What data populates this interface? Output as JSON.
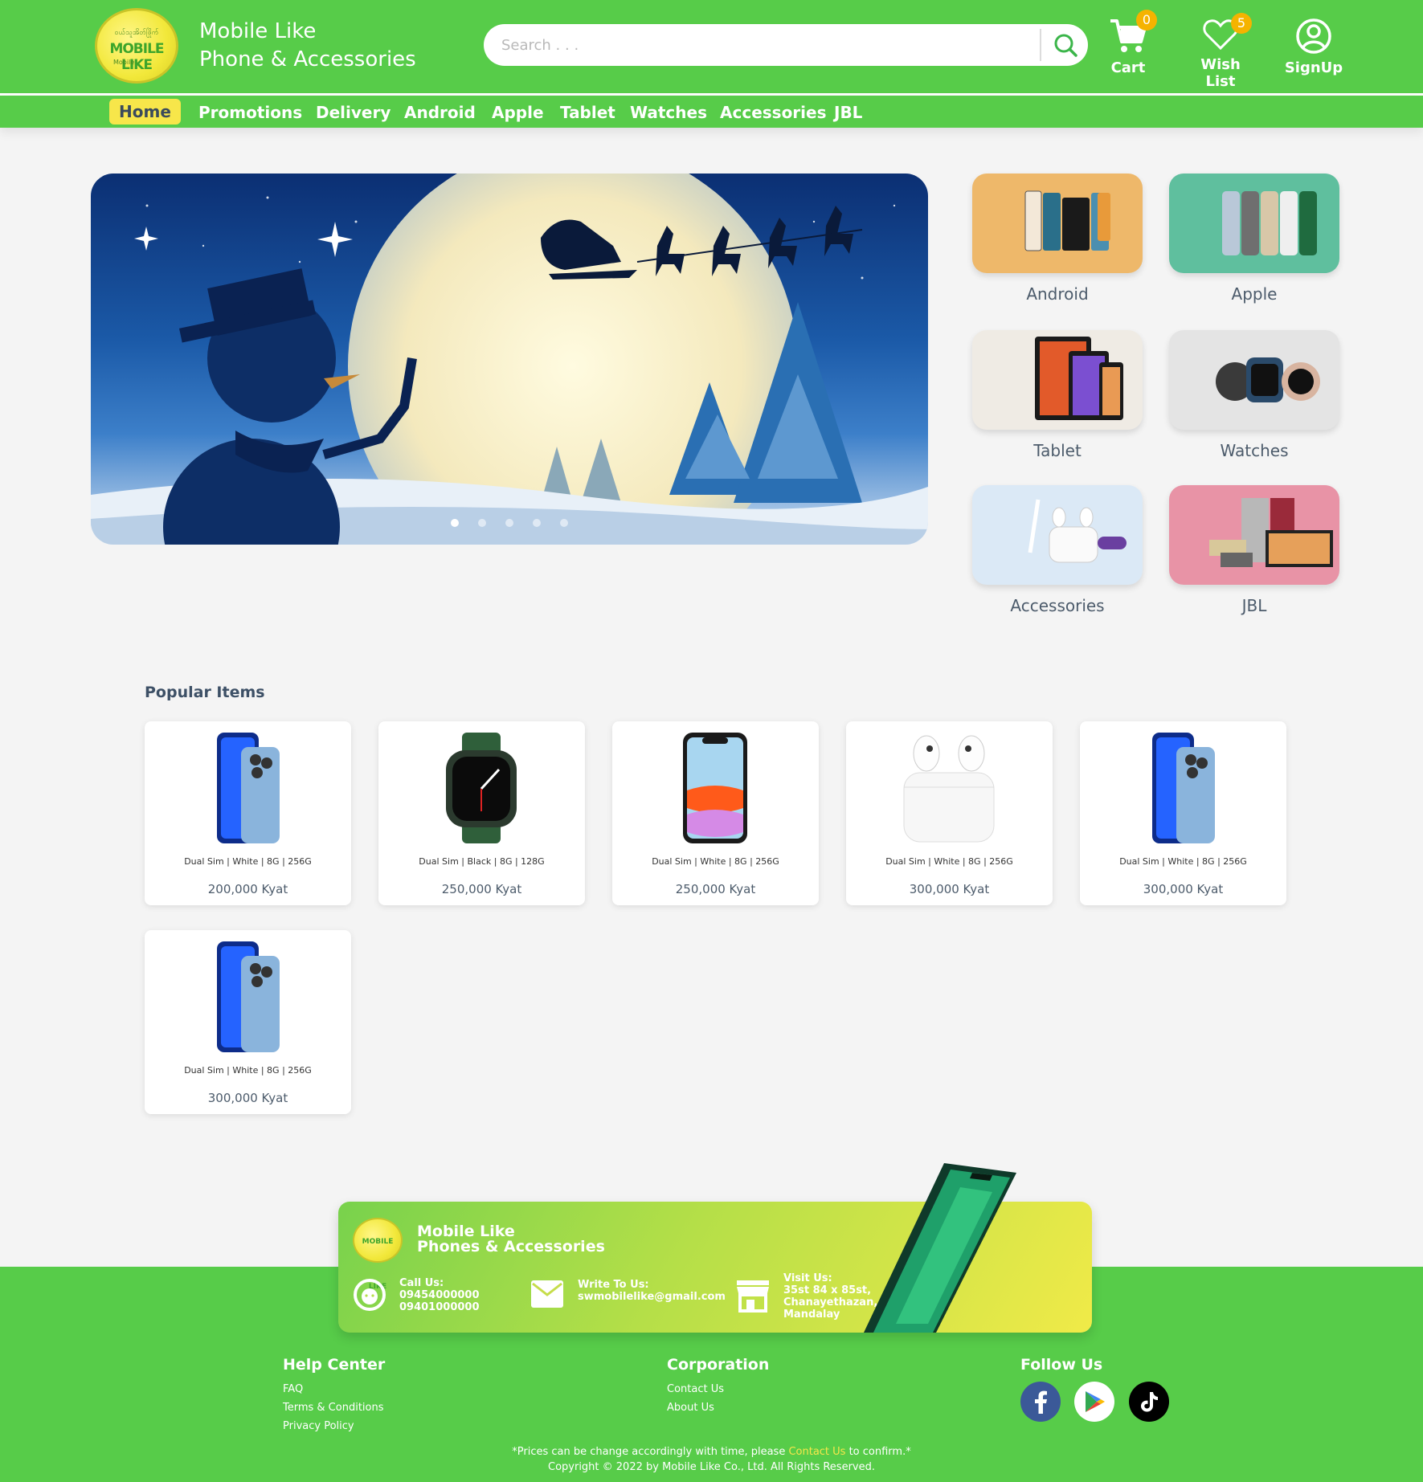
{
  "header": {
    "brand_line1": "Mobile Like",
    "brand_line2": "Phone & Accessories",
    "logo_top": "ဝယ်သူအိတ်ဖြိုက်",
    "logo_main": "MOBILE LIKE",
    "logo_bottom": "Mobile",
    "search_placeholder": "Search . . .",
    "cart_label": "Cart",
    "cart_count": "0",
    "wishlist_label": "Wish List",
    "wishlist_count": "5",
    "signup_label": "SignUp"
  },
  "nav": {
    "items": [
      "Home",
      "Promotions",
      "Delivery",
      "Android",
      "Apple",
      "Tablet",
      "Watches",
      "Accessories",
      "JBL"
    ],
    "active": "Home"
  },
  "banner": {
    "slides": 5,
    "active_slide": 1
  },
  "categories": [
    {
      "name": "Android",
      "color": "#eeb86a"
    },
    {
      "name": "Apple",
      "color": "#5fbf9e"
    },
    {
      "name": "Tablet",
      "color": "#efebe4"
    },
    {
      "name": "Watches",
      "color": "#e4e4e4"
    },
    {
      "name": "Accessories",
      "color": "#dbe9f6"
    },
    {
      "name": "JBL",
      "color": "#e893a6"
    }
  ],
  "popular": {
    "title": "Popular Items",
    "items": [
      {
        "spec": "Dual Sim | White | 8G | 256G",
        "price": "200,000 Kyat",
        "image": "iphone-13-pro-blue"
      },
      {
        "spec": "Dual Sim | Black | 8G | 128G",
        "price": "250,000 Kyat",
        "image": "apple-watch-green"
      },
      {
        "spec": "Dual Sim | White | 8G | 256G",
        "price": "250,000 Kyat",
        "image": "iphone-11"
      },
      {
        "spec": "Dual Sim | White | 8G | 256G",
        "price": "300,000 Kyat",
        "image": "airpods"
      },
      {
        "spec": "Dual Sim | White | 8G | 256G",
        "price": "300,000 Kyat",
        "image": "iphone-13-pro-blue"
      },
      {
        "spec": "Dual Sim | White | 8G | 256G",
        "price": "300,000 Kyat",
        "image": "iphone-13-pro-blue"
      }
    ]
  },
  "footer": {
    "brand_line1": "Mobile Like",
    "brand_line2": "Phones & Accessories",
    "call_title": "Call Us:",
    "call_1": "09454000000",
    "call_2": "09401000000",
    "write_title": "Write To Us:",
    "email": "swmobilelike@gmail.com",
    "visit_title": "Visit Us:",
    "address_1": "35st 84 x 85st,",
    "address_2": "Chanayethazan,",
    "address_3": "Mandalay",
    "help_title": "Help Center",
    "help_links": [
      "FAQ",
      "Terms & Conditions",
      "Privacy Policy"
    ],
    "corp_title": "Corporation",
    "corp_links": [
      "Contact Us",
      "About Us"
    ],
    "follow_title": "Follow Us",
    "note_pre": "*Prices can be change accordingly with time, please ",
    "note_link": "Contact Us",
    "note_post": " to confirm.*",
    "copyright": "Copyright © 2022 by Mobile Like Co., Ltd. All Rights Reserved."
  }
}
